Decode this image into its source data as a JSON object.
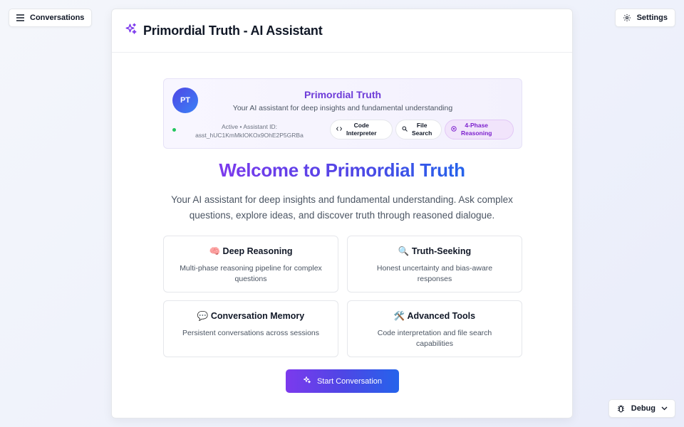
{
  "top_bar": {
    "conversations_label": "Conversations",
    "settings_label": "Settings",
    "debug_label": "Debug"
  },
  "header": {
    "title": "Primordial Truth - AI Assistant"
  },
  "assistant": {
    "initials": "PT",
    "name": "Primordial Truth",
    "description": "Your AI assistant for deep insights and fundamental understanding",
    "status_line1": "Active • Assistant ID:",
    "status_line2": "asst_hUC1KmMkIOKOx9OhE2P5GRBa",
    "tools": [
      {
        "line1": "Code",
        "line2": "Interpreter"
      },
      {
        "line1": "File",
        "line2": "Search"
      },
      {
        "line1": "4-Phase",
        "line2": "Reasoning"
      }
    ]
  },
  "welcome": {
    "title": "Welcome to Primordial Truth",
    "subtitle": "Your AI assistant for deep insights and fundamental understanding. Ask complex questions, explore ideas, and discover truth through reasoned dialogue."
  },
  "features": [
    {
      "title": "🧠 Deep Reasoning",
      "desc": "Multi-phase reasoning pipeline for complex questions"
    },
    {
      "title": "🔍 Truth-Seeking",
      "desc": "Honest uncertainty and bias-aware responses"
    },
    {
      "title": "💬 Conversation Memory",
      "desc": "Persistent conversations across sessions"
    },
    {
      "title": "🛠️ Advanced Tools",
      "desc": "Code interpretation and file search capabilities"
    }
  ],
  "start_button_label": "Start Conversation",
  "colors": {
    "accent_purple": "#7c3aed",
    "accent_blue": "#2563eb",
    "status_active": "#22c55e",
    "reasoning_chip": "#f1e4fb"
  }
}
